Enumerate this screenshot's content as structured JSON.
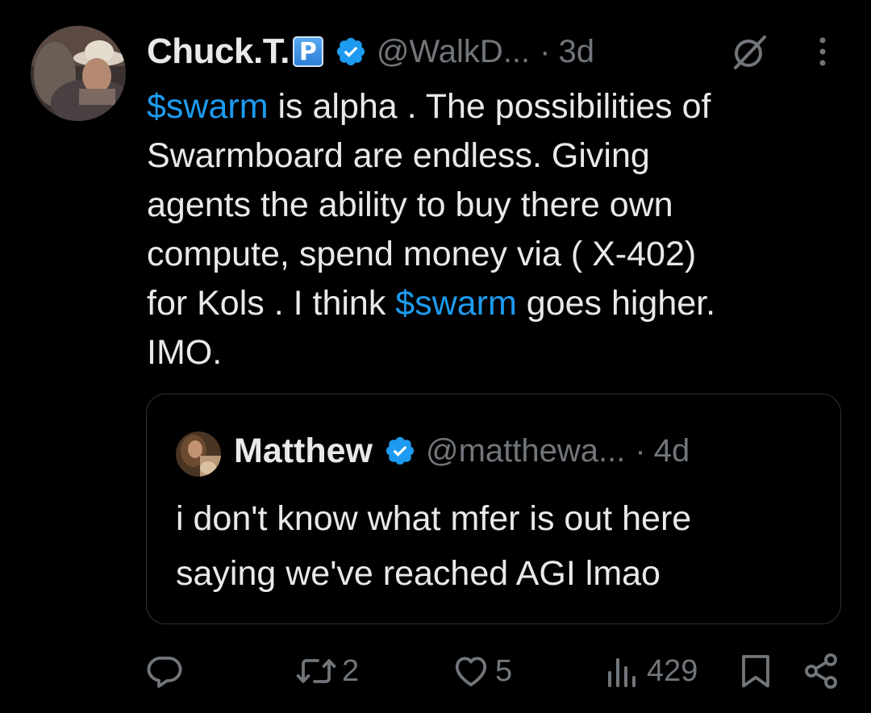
{
  "tweet": {
    "display_name": "Chuck.T.",
    "badge": "P",
    "handle": "@WalkD...",
    "separator": "·",
    "time": "3d",
    "text_lines": [
      [
        {
          "t": "$swarm",
          "tag": true
        },
        {
          "t": " is alpha . The possibilities of",
          "tag": false
        }
      ],
      [
        {
          "t": "Swarmboard are endless. Giving",
          "tag": false
        }
      ],
      [
        {
          "t": "agents the ability to buy there own",
          "tag": false
        }
      ],
      [
        {
          "t": "compute, spend money via ( X-402)",
          "tag": false
        }
      ],
      [
        {
          "t": "for Kols . I think ",
          "tag": false
        },
        {
          "t": "$swarm",
          "tag": true
        },
        {
          "t": " goes higher.",
          "tag": false
        }
      ],
      [
        {
          "t": "IMO.",
          "tag": false
        }
      ]
    ]
  },
  "quote": {
    "display_name": "Matthew",
    "handle": "@matthewa...",
    "separator": "·",
    "time": "4d",
    "text_lines": [
      "i don't know what mfer is out here",
      "saying we've reached AGI lmao"
    ]
  },
  "actions": {
    "reply_count": "",
    "retweet_count": "2",
    "like_count": "5",
    "views_count": "429"
  },
  "colors": {
    "background": "#000000",
    "text": "#e7e9ea",
    "secondary": "#71767b",
    "accent": "#1d9bf0",
    "border": "#2f3336"
  },
  "icons": {
    "verified": "verified-badge-icon",
    "grok": "grok-icon",
    "more": "more-vertical-icon",
    "reply": "reply-icon",
    "retweet": "retweet-icon",
    "like": "heart-icon",
    "views": "views-icon",
    "bookmark": "bookmark-icon",
    "share": "share-icon"
  }
}
